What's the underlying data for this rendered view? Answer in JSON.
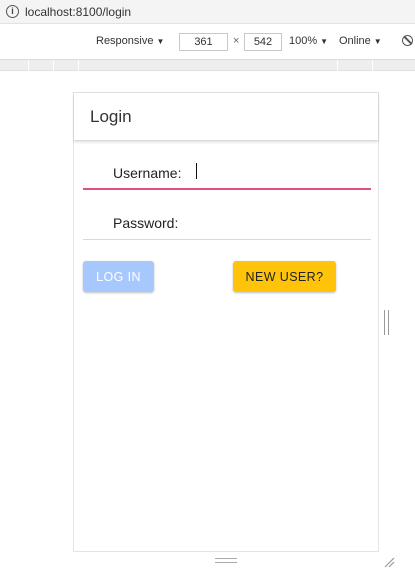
{
  "browser": {
    "url": "localhost:8100/login"
  },
  "devtools": {
    "device": "Responsive",
    "width": "361",
    "times": "×",
    "height": "542",
    "zoom": "100%",
    "network": "Online",
    "dropdown_glyph": "▼"
  },
  "app": {
    "title": "Login",
    "username_label": "Username:",
    "username_value": "",
    "password_label": "Password:",
    "password_value": "",
    "login_button": "LOG IN",
    "new_user_button": "NEW USER?"
  },
  "colors": {
    "login_button_bg": "#a6c8ff",
    "new_user_button_bg": "#ffc409",
    "active_underline": "#e0507a"
  }
}
